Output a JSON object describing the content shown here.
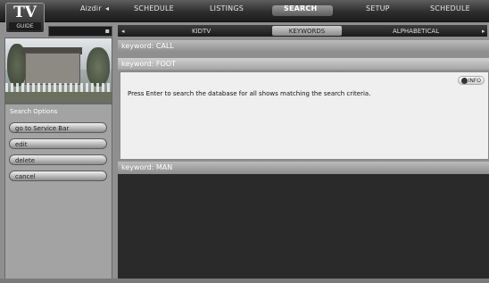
{
  "logo": {
    "top": "TV",
    "bottom": "GUIDE"
  },
  "nav": {
    "items": [
      "Aizdir",
      "SCHEDULE",
      "LISTINGS",
      "SEARCH",
      "SETUP",
      "SCHEDULE"
    ],
    "active_index": 3
  },
  "categories": [
    "KIDTV",
    "KEYWORDS",
    "ALPHABETICAL"
  ],
  "active_category": "KEYWORDS",
  "sidebar": {
    "title": "Search Options",
    "buttons": [
      "go to Service Bar",
      "edit",
      "delete",
      "cancel"
    ]
  },
  "rows": [
    "keyword: CALL",
    "keyword: FOOT",
    "keyword: MAN"
  ],
  "detail": {
    "info_label": "INFO",
    "text": "Press Enter to search the database for all shows matching the search criteria."
  },
  "colors": {
    "background": "#8f8f8f",
    "dark": "#2a2a2a",
    "topbar": "#2e2e2e"
  }
}
